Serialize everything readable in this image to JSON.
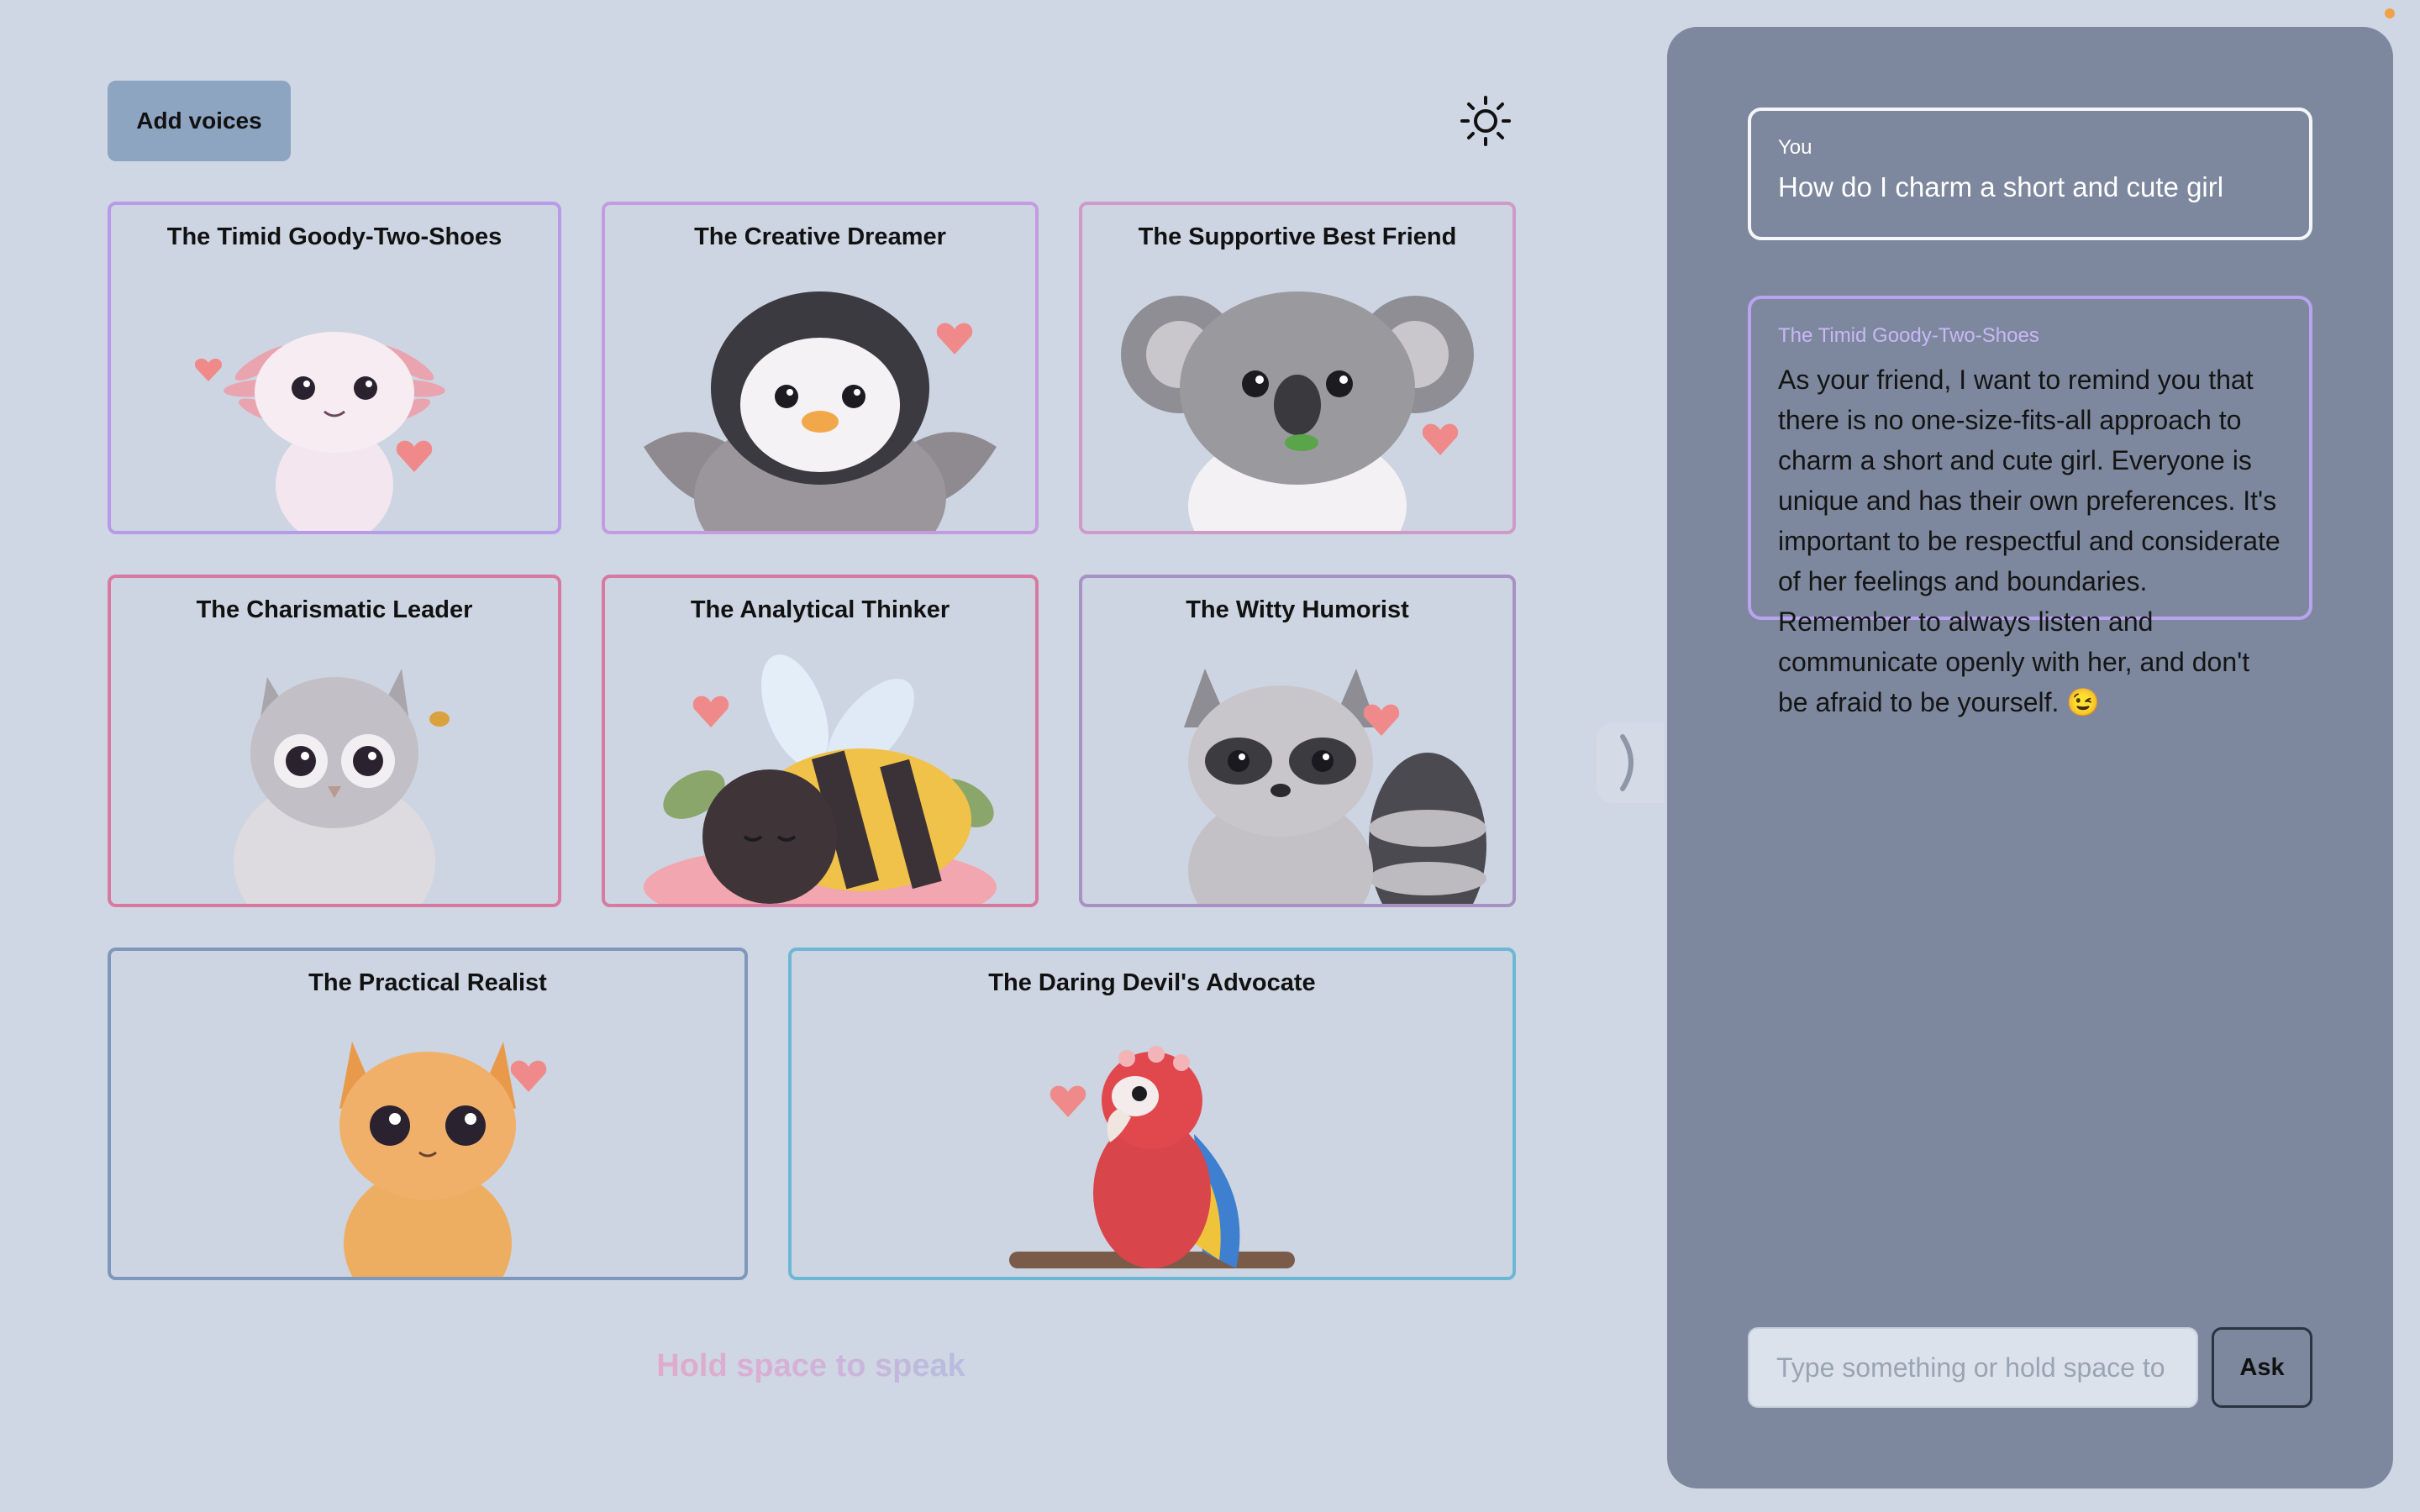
{
  "header": {
    "add_voices_label": "Add voices"
  },
  "voices": [
    {
      "title": "The Timid Goody-Two-Shoes",
      "animal": "axolotl"
    },
    {
      "title": "The Creative Dreamer",
      "animal": "penguin"
    },
    {
      "title": "The Supportive Best Friend",
      "animal": "koala"
    },
    {
      "title": "The Charismatic Leader",
      "animal": "owl"
    },
    {
      "title": "The Analytical Thinker",
      "animal": "bee"
    },
    {
      "title": "The Witty Humorist",
      "animal": "raccoon"
    },
    {
      "title": "The Practical Realist",
      "animal": "cat"
    },
    {
      "title": "The Daring Devil's Advocate",
      "animal": "parrot"
    }
  ],
  "speak_hint": "Hold space to speak",
  "chat": {
    "user_label": "You",
    "user_message": "How do I charm a short and cute girl",
    "reply_label": "The Timid Goody-Two-Shoes",
    "reply_message": "As your friend, I want to remind you that there is no one-size-fits-all approach to charm a short and cute girl. Everyone is unique and has their own preferences. It's important to be respectful and considerate of her feelings and boundaries. Remember to always listen and communicate openly with her, and don't be afraid to be yourself. 😉"
  },
  "composer": {
    "placeholder": "Type something or hold space to speak",
    "ask_label": "Ask"
  },
  "colors": {
    "background": "#cfd7e4",
    "panel": "#7d889e",
    "button": "#8ea5c2"
  }
}
